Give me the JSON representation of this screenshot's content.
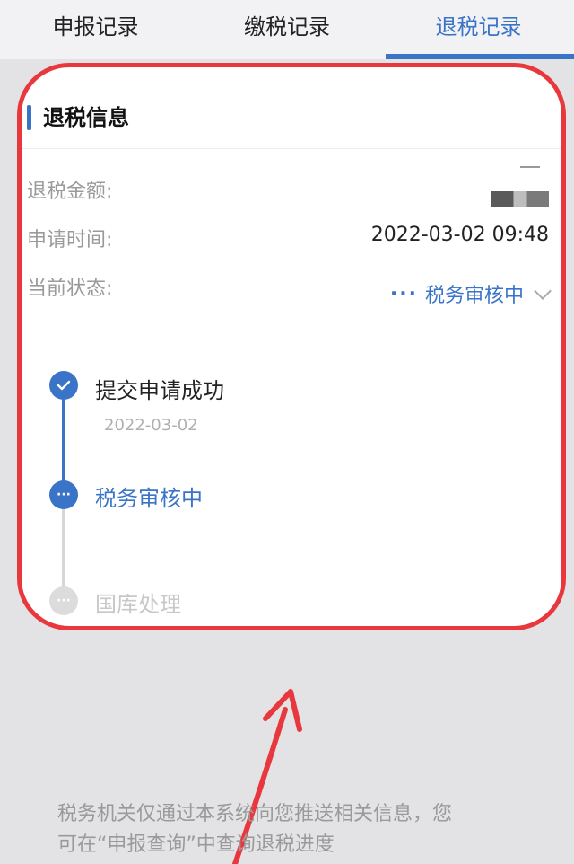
{
  "tabs": [
    {
      "label": "申报记录",
      "active": false
    },
    {
      "label": "缴税记录",
      "active": false
    },
    {
      "label": "退税记录",
      "active": true
    }
  ],
  "card": {
    "title": "退税信息",
    "amount": {
      "label": "退税金额:",
      "value": "—"
    },
    "time": {
      "label": "申请时间:",
      "value": "2022-03-02 09:48"
    },
    "status": {
      "label": "当前状态:",
      "value": "税务审核中"
    }
  },
  "timeline": [
    {
      "title": "提交申请成功",
      "date": "2022-03-02",
      "state": "done",
      "icon": "check-icon"
    },
    {
      "title": "税务审核中",
      "state": "current",
      "icon": "ellipsis-icon"
    },
    {
      "title": "国库处理",
      "state": "pending",
      "icon": "ellipsis-icon"
    }
  ],
  "notice": {
    "line1": "税务机关仅通过本系统向您推送相关信息，您",
    "line2": "可在“申报查询”中查询退税进度"
  },
  "colors": {
    "accent": "#3a74c8",
    "highlight_border": "#e8383d"
  }
}
